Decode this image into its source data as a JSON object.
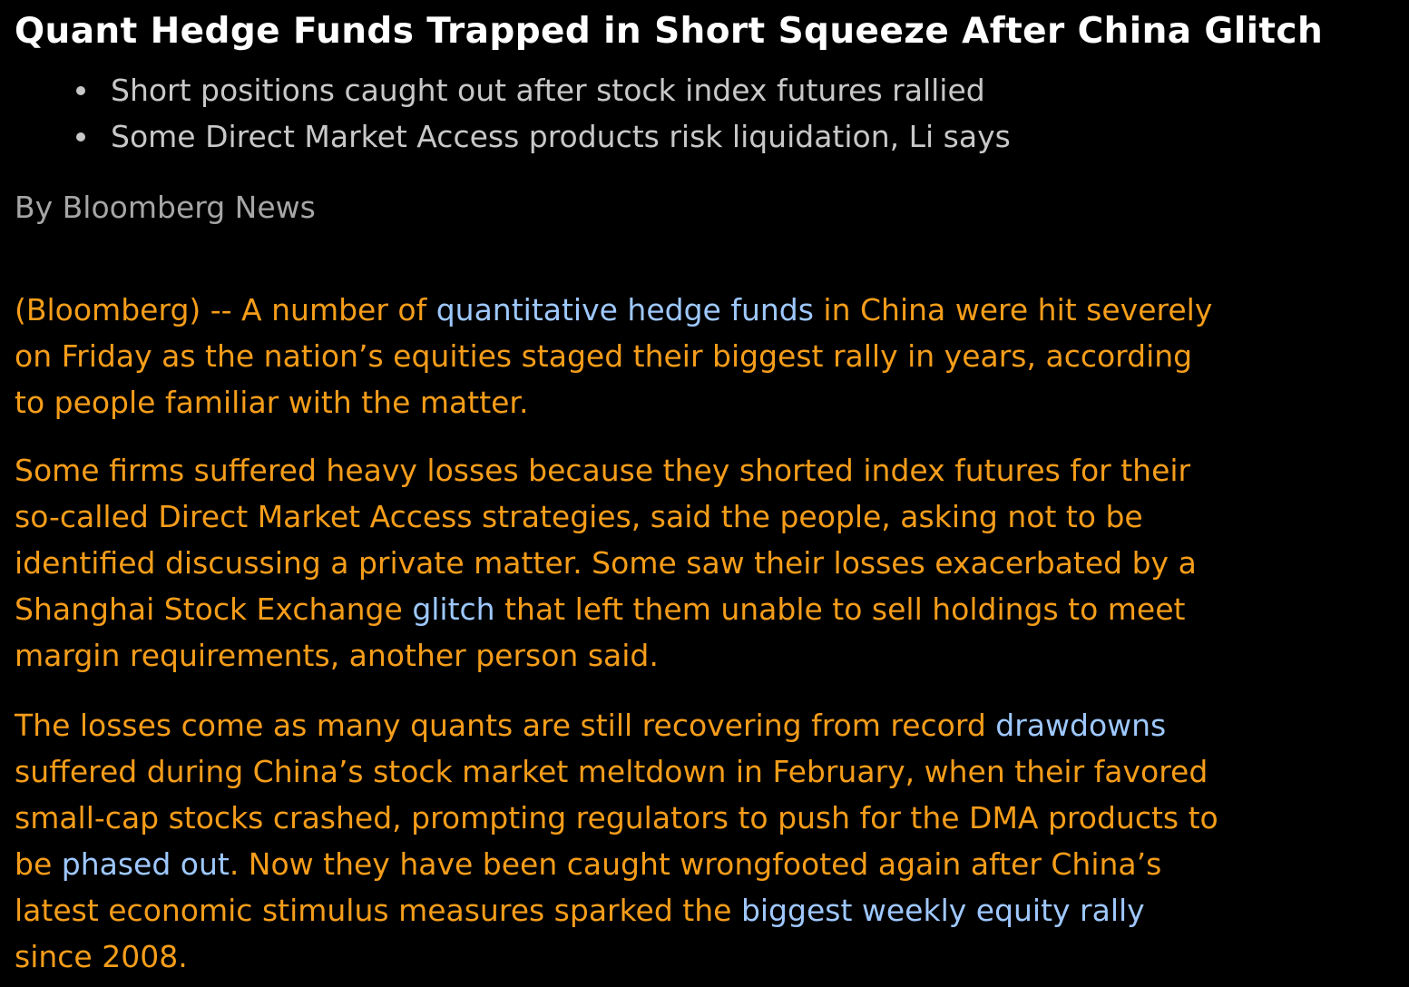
{
  "article": {
    "headline": "Quant Hedge Funds Trapped in Short Squeeze After China Glitch",
    "bullets": [
      "Short positions caught out after stock index futures rallied",
      "Some Direct Market Access products risk liquidation, Li says"
    ],
    "byline": "By Bloomberg News",
    "paragraphs": [
      {
        "lines": [
          [
            {
              "text": "(Bloomberg) -- A number of ",
              "link": false
            },
            {
              "text": "quantitative hedge funds",
              "link": true
            },
            {
              "text": " in China were hit severely",
              "link": false
            }
          ],
          [
            {
              "text": "on Friday as the nation’s equities staged their biggest rally in years, according",
              "link": false
            }
          ],
          [
            {
              "text": "to people familiar with the matter.",
              "link": false
            }
          ]
        ]
      },
      {
        "lines": [
          [
            {
              "text": "Some firms suffered heavy losses because they shorted index futures for their",
              "link": false
            }
          ],
          [
            {
              "text": "so-called Direct Market Access strategies, said the people, asking not to be",
              "link": false
            }
          ],
          [
            {
              "text": "identified discussing a private matter. Some saw their losses exacerbated by a",
              "link": false
            }
          ],
          [
            {
              "text": "Shanghai Stock Exchange ",
              "link": false
            },
            {
              "text": "glitch",
              "link": true
            },
            {
              "text": " that left them unable to sell holdings to meet",
              "link": false
            }
          ],
          [
            {
              "text": "margin requirements, another person said.",
              "link": false
            }
          ]
        ]
      },
      {
        "lines": [
          [
            {
              "text": "The losses come as many quants are still recovering from record ",
              "link": false
            },
            {
              "text": "drawdowns",
              "link": true
            }
          ],
          [
            {
              "text": "suffered during China’s stock market meltdown in February, when their favored",
              "link": false
            }
          ],
          [
            {
              "text": "small-cap stocks crashed, prompting regulators to push for the DMA products to",
              "link": false
            }
          ],
          [
            {
              "text": "be ",
              "link": false
            },
            {
              "text": "phased out",
              "link": true
            },
            {
              "text": ". Now they have been caught wrongfooted again after China’s",
              "link": false
            }
          ],
          [
            {
              "text": "latest economic stimulus measures sparked the ",
              "link": false
            },
            {
              "text": "biggest weekly equity rally",
              "link": true
            }
          ],
          [
            {
              "text": "since 2008.",
              "link": false
            }
          ]
        ]
      }
    ]
  },
  "colors": {
    "background": "#000000",
    "headline": "#ffffff",
    "bullet_text": "#c8c8c8",
    "byline": "#a6a6a6",
    "body_text": "#f59d1a",
    "link": "#9ec8ff"
  }
}
